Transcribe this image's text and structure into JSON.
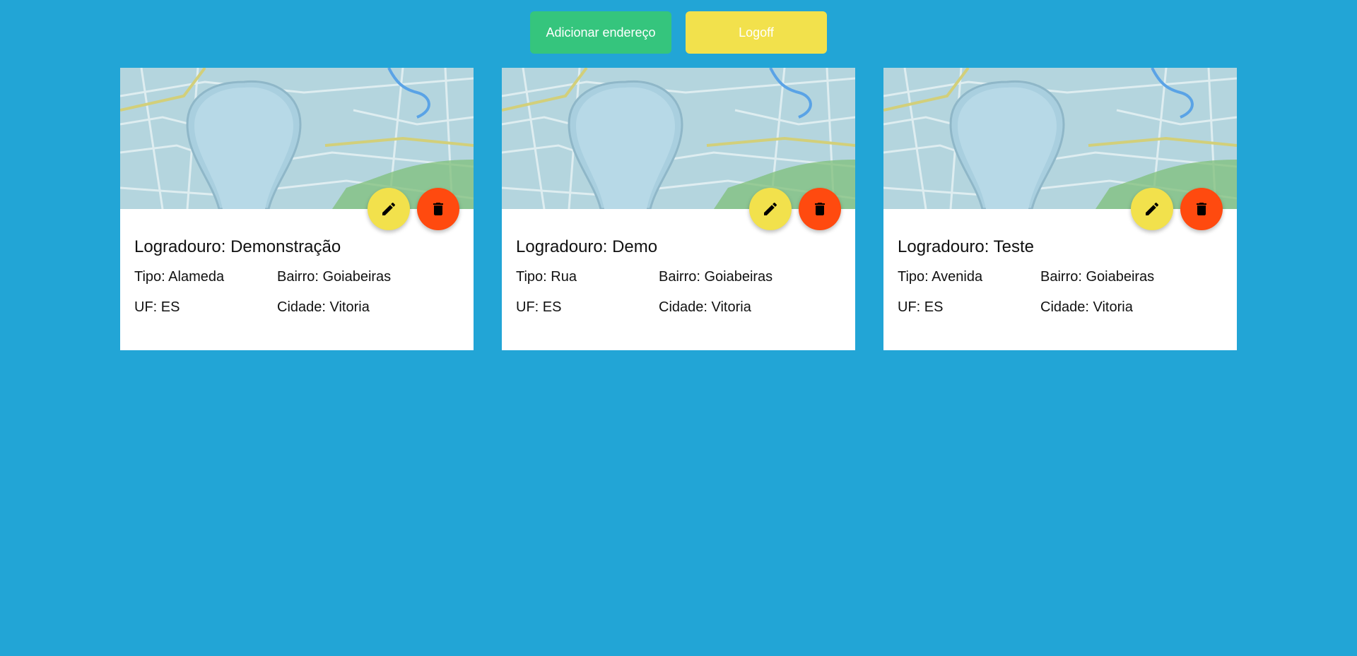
{
  "toolbar": {
    "add_label": "Adicionar endereço",
    "logoff_label": "Logoff"
  },
  "colors": {
    "background": "#22a5d6",
    "add_button": "#35c57d",
    "logoff_button": "#f2e14c",
    "edit_button": "#f2e14c",
    "delete_button": "#ff4a0f"
  },
  "icons": {
    "edit": "pencil-icon",
    "delete": "trash-icon",
    "media": "map-pin-illustration"
  },
  "cards": [
    {
      "logradouro": "Logradouro: Demonstração",
      "tipo": "Tipo: Alameda",
      "bairro": "Bairro: Goiabeiras",
      "uf": "UF: ES",
      "cidade": "Cidade: Vitoria"
    },
    {
      "logradouro": "Logradouro: Demo",
      "tipo": "Tipo: Rua",
      "bairro": "Bairro: Goiabeiras",
      "uf": "UF: ES",
      "cidade": "Cidade: Vitoria"
    },
    {
      "logradouro": "Logradouro: Teste",
      "tipo": "Tipo: Avenida",
      "bairro": "Bairro: Goiabeiras",
      "uf": "UF: ES",
      "cidade": "Cidade: Vitoria"
    }
  ]
}
